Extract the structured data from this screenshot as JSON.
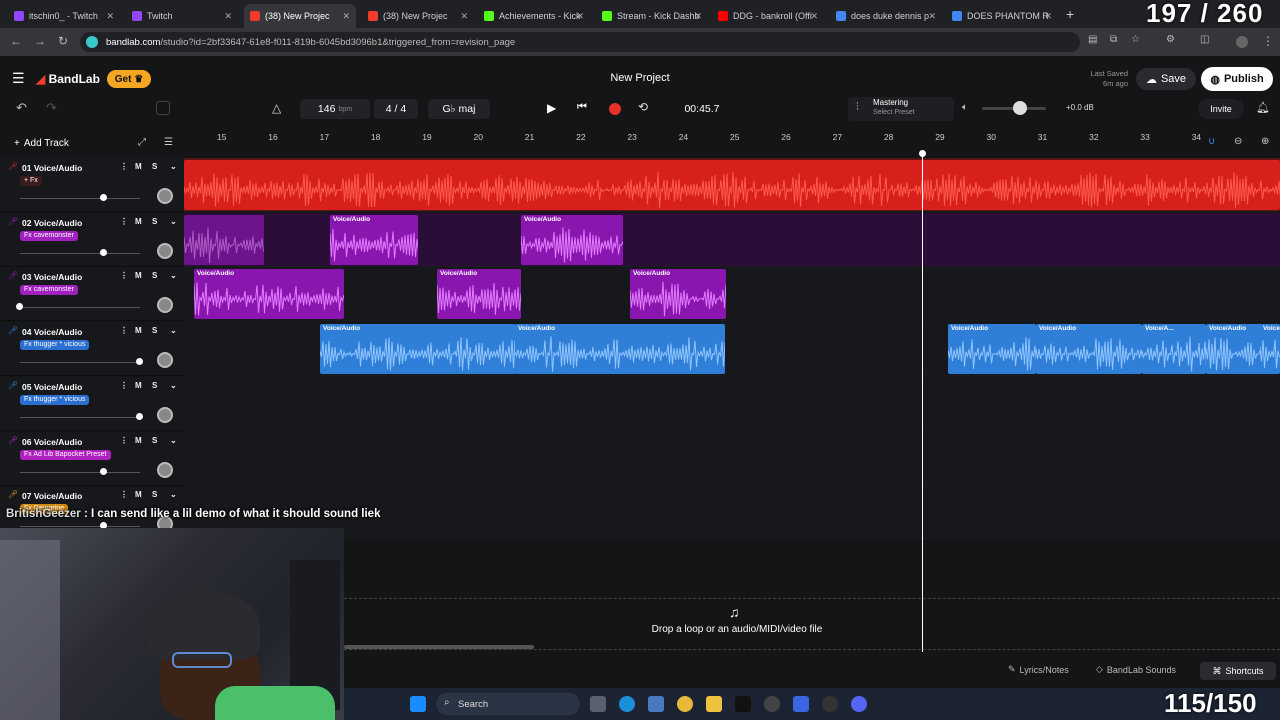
{
  "browser": {
    "tabs": [
      {
        "label": "itschin0_ - Twitch",
        "color": "#9147ff"
      },
      {
        "label": "Twitch",
        "color": "#9147ff"
      },
      {
        "label": "(38) New Projec",
        "color": "#f2392c",
        "active": true
      },
      {
        "label": "(38) New Projec",
        "color": "#f2392c"
      },
      {
        "label": "Achievements - Kick",
        "color": "#53fc18"
      },
      {
        "label": "Stream - Kick Dashb",
        "color": "#53fc18"
      },
      {
        "label": "DDG - bankroll (Offi",
        "color": "#ff0000"
      },
      {
        "label": "does duke dennis p",
        "color": "#4285f4"
      },
      {
        "label": "DOES PHANTOM R",
        "color": "#4285f4"
      }
    ],
    "tab_counter": "197 / 260",
    "url_host": "bandlab.com",
    "url_path": "/studio?id=2bf33647-61e8-f011-819b-6045bd3096b1&triggered_from=revision_page",
    "get_label": "Get"
  },
  "app": {
    "logo": "BandLab",
    "get_button": "Get",
    "title": "New Project",
    "last_saved_label": "Last Saved",
    "last_saved_value": "6m ago",
    "save": "Save",
    "publish": "Publish"
  },
  "transport": {
    "bpm": "146",
    "bpm_unit": "bpm",
    "time_signature": "4 / 4",
    "key": "G♭ maj",
    "time": "00:45.7",
    "mastering_title": "Mastering",
    "mastering_sub": "Select Preset",
    "volume_db": "+0.0 dB",
    "volume_level": 0.6,
    "invite": "Invite"
  },
  "tracks_panel": {
    "add_track": "Add Track",
    "tracks": [
      {
        "name": "01 Voice/Audio",
        "fx": "+ Fx",
        "fx_color": "#3a1c1c",
        "icon_color": "#e8312a",
        "volume": 0.7
      },
      {
        "name": "02 Voice/Audio",
        "fx": "Fx cavemonster",
        "fx_color": "#a020c0",
        "icon_color": "#a020c0",
        "volume": 0.7
      },
      {
        "name": "03 Voice/Audio",
        "fx": "Fx cavemonster",
        "fx_color": "#a020c0",
        "icon_color": "#a020c0",
        "volume": 0.0
      },
      {
        "name": "04 Voice/Audio",
        "fx": "Fx thugger * vicious",
        "fx_color": "#2b6fd1",
        "icon_color": "#3a8ef0",
        "volume": 1.0
      },
      {
        "name": "05 Voice/Audio",
        "fx": "Fx thugger * vicious",
        "fx_color": "#2b6fd1",
        "icon_color": "#3a8ef0",
        "volume": 1.0
      },
      {
        "name": "06 Voice/Audio",
        "fx": "Fx Ad Lib Bapocket Preset",
        "fx_color": "#b020c0",
        "icon_color": "#c030d0",
        "volume": 0.7
      },
      {
        "name": "07 Voice/Audio",
        "fx": "Fx Peregrine",
        "fx_color": "#d08a10",
        "icon_color": "#f5a623",
        "volume": 0.7
      }
    ]
  },
  "ruler": {
    "bars": [
      "15",
      "16",
      "17",
      "18",
      "19",
      "20",
      "21",
      "22",
      "23",
      "24",
      "25",
      "26",
      "27",
      "28",
      "29",
      "30",
      "31",
      "32",
      "33",
      "34"
    ]
  },
  "clip_label": "Voice/Audio",
  "clip_label_short": "Voice/A...",
  "chat": {
    "user": "BritishGeezer",
    "message": ": I can send like a lil demo of what it should sound liek"
  },
  "drop_zone": "Drop a loop or an audio/MIDI/video file",
  "footer": {
    "lyrics": "Lyrics/Notes",
    "sounds": "BandLab Sounds",
    "shortcuts": "Shortcuts"
  },
  "taskbar": {
    "search": "Search"
  },
  "overlay_counter": "115/150",
  "colors": {
    "red_track": "#d7201c",
    "purple_track": "#8a16b0",
    "blue_track": "#2f7fd8",
    "bg": "#141517"
  }
}
